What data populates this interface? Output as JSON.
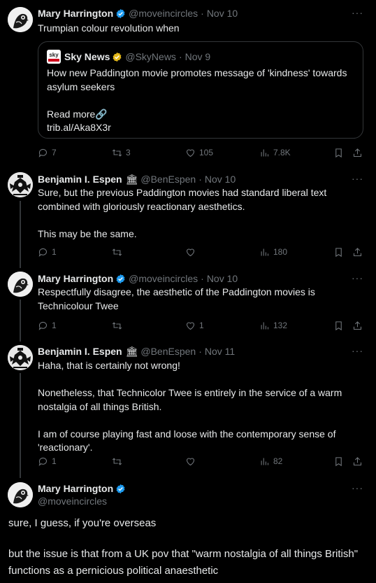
{
  "tweets": [
    {
      "name": "Mary Harrington",
      "handle": "@moveincircles",
      "sep": "·",
      "date": "Nov 10",
      "text": "Trumpian colour revolution when",
      "quote": {
        "name": "Sky News",
        "handle": "@SkyNews",
        "sep": "·",
        "date": "Nov 9",
        "logo_text": "sky",
        "text": "How new Paddington movie promotes message of 'kindness' towards asylum seekers\n\nRead more🔗\ntrib.al/Aka8X3r"
      },
      "replies": "7",
      "retweets": "3",
      "likes": "105",
      "views": "7.8K"
    },
    {
      "name": "Benjamin I. Espen",
      "emoji": "🏛",
      "handle": "@BenEspen",
      "sep": "·",
      "date": "Nov 10",
      "text": "Sure, but the previous Paddington movies had standard liberal text combined with gloriously reactionary aesthetics.\n\nThis may be the same.",
      "replies": "1",
      "retweets": "",
      "likes": "",
      "views": "180"
    },
    {
      "name": "Mary Harrington",
      "handle": "@moveincircles",
      "sep": "·",
      "date": "Nov 10",
      "text": "Respectfully disagree, the aesthetic of the Paddington movies is Technicolour Twee",
      "replies": "1",
      "retweets": "",
      "likes": "1",
      "views": "132"
    },
    {
      "name": "Benjamin I. Espen",
      "emoji": "🏛",
      "handle": "@BenEspen",
      "sep": "·",
      "date": "Nov 11",
      "text": "Haha, that is certainly not wrong!\n\nNonetheless, that Technicolor Twee is entirely in the service of a warm nostalgia of all things British.\n\nI am of course playing fast and loose with the contemporary sense of 'reactionary'.",
      "replies": "1",
      "retweets": "",
      "likes": "",
      "views": "82"
    }
  ],
  "main_tweet": {
    "name": "Mary Harrington",
    "handle": "@moveincircles",
    "text1": "sure, I guess, if you're overseas",
    "text2": "but the issue is that from a UK pov that \"warm nostalgia of all things British\" functions as a pernicious political anaesthetic"
  },
  "more_glyph": "···",
  "colors": {
    "background": "#000000",
    "text": "#e7e9ea",
    "muted": "#71767b",
    "verified_blue": "#1d9bf0",
    "verified_gold": "#e2b719",
    "border": "#333639"
  }
}
